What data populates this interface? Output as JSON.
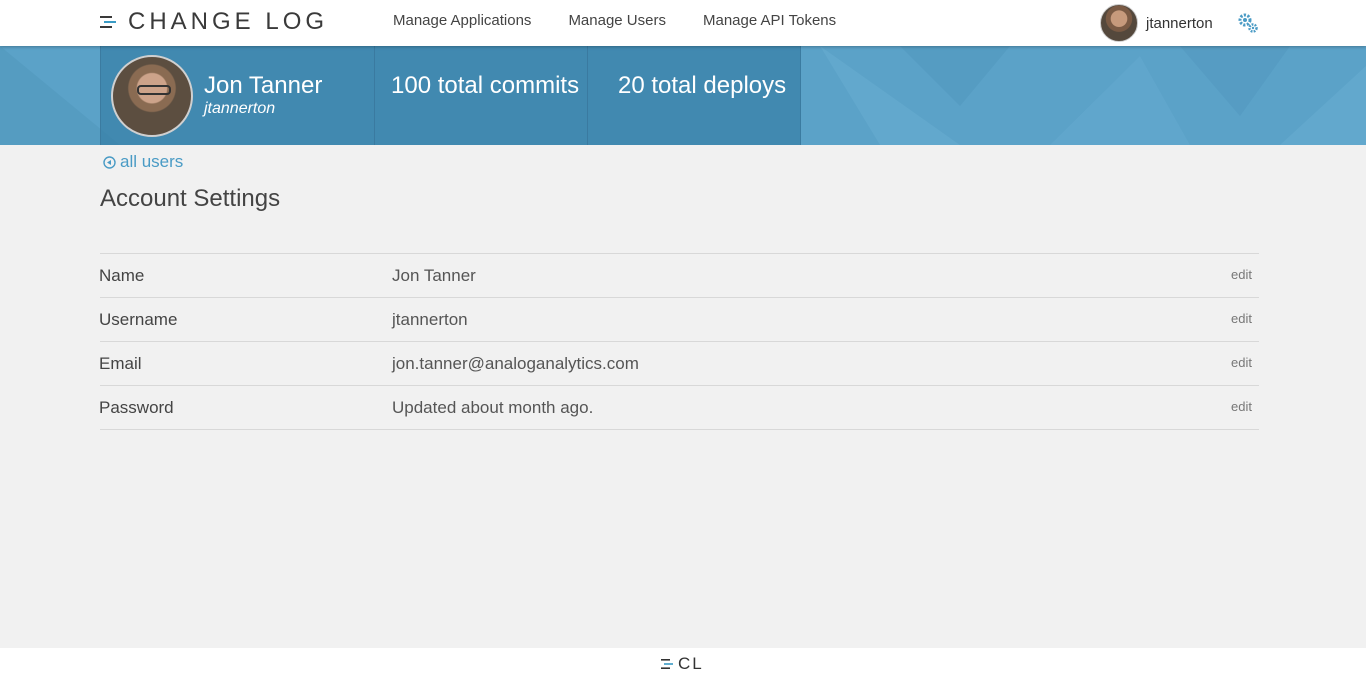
{
  "brand": {
    "name": "CHANGE LOG",
    "footer_name": "CL"
  },
  "nav": {
    "links": [
      "Manage Applications",
      "Manage Users",
      "Manage API Tokens"
    ],
    "username": "jtannerton"
  },
  "profile": {
    "name": "Jon Tanner",
    "handle": "jtannerton",
    "commits": "100 total commits",
    "deploys": "20 total deploys"
  },
  "content": {
    "back_link": "all users",
    "title": "Account Settings",
    "rows": [
      {
        "label": "Name",
        "value": "Jon Tanner",
        "action": "edit"
      },
      {
        "label": "Username",
        "value": "jtannerton",
        "action": "edit"
      },
      {
        "label": "Email",
        "value": "jon.tanner@analoganalytics.com",
        "action": "edit"
      },
      {
        "label": "Password",
        "value": "Updated about month ago.",
        "action": "edit"
      }
    ]
  },
  "colors": {
    "accent": "#4a9bc5",
    "banner": "#5ba2c8",
    "banner_card": "#3880a6",
    "background": "#f1f1f1"
  },
  "icons": {
    "brand": "changelog-logo-icon",
    "settings": "gear-icon",
    "back": "circle-arrow-left-icon"
  }
}
